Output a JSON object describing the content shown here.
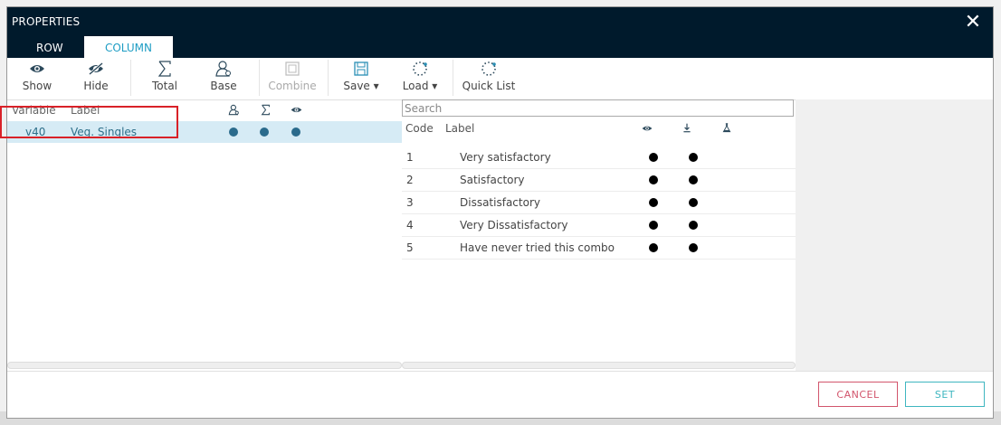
{
  "dialog": {
    "title": "PROPERTIES",
    "close_glyph": "✕",
    "tabs": [
      {
        "label": "ROW",
        "active": false
      },
      {
        "label": "COLUMN",
        "active": true
      }
    ]
  },
  "toolbar": {
    "show": "Show",
    "hide": "Hide",
    "total": "Total",
    "base": "Base",
    "combine": "Combine",
    "save": "Save ▾",
    "load": "Load ▾",
    "quick_list": "Quick List"
  },
  "left_table": {
    "headers": {
      "variable": "Variable",
      "label": "Label"
    },
    "header_icons": [
      "base-person-icon",
      "sigma-icon",
      "eye-icon"
    ],
    "rows": [
      {
        "variable": "v40",
        "label": "Veg. Singles",
        "base": true,
        "total": true,
        "show": true
      }
    ]
  },
  "search": {
    "placeholder": "Search",
    "value": ""
  },
  "right_table": {
    "headers": {
      "code": "Code",
      "label": "Label"
    },
    "header_icons": [
      "eye-icon",
      "download-icon",
      "flask-icon"
    ],
    "rows": [
      {
        "code": "1",
        "label": "Very satisfactory"
      },
      {
        "code": "2",
        "label": "Satisfactory"
      },
      {
        "code": "3",
        "label": "Dissatisfactory"
      },
      {
        "code": "4",
        "label": "Very Dissatisfactory"
      },
      {
        "code": "5",
        "label": "Have never tried this combo"
      }
    ]
  },
  "buttons": {
    "cancel": "CANCEL",
    "set": "SET"
  },
  "colors": {
    "header_bg": "#001a2c",
    "active_tab_text": "#1e9dc4",
    "selected_row_bg": "#d6ebf5",
    "highlight_border": "#d92128",
    "cancel": "#d2556c",
    "set": "#3fb6c0"
  }
}
